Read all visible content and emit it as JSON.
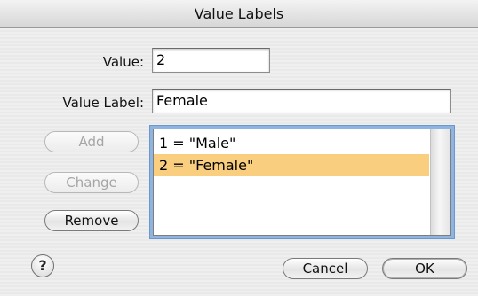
{
  "window": {
    "title": "Value Labels"
  },
  "form": {
    "value_label": "Value:",
    "value_input": "2",
    "valuelabel_label": "Value Label:",
    "valuelabel_input": "Female"
  },
  "buttons": {
    "add": "Add",
    "change": "Change",
    "remove": "Remove",
    "cancel": "Cancel",
    "ok": "OK",
    "help": "?"
  },
  "list": {
    "items": [
      "1 = \"Male\"",
      "2 = \"Female\""
    ],
    "selected_index": 1
  },
  "colors": {
    "selection": "#f9ce7e",
    "focus_ring": "#8fb4e0"
  },
  "icons": {
    "help": "question-mark-icon"
  }
}
